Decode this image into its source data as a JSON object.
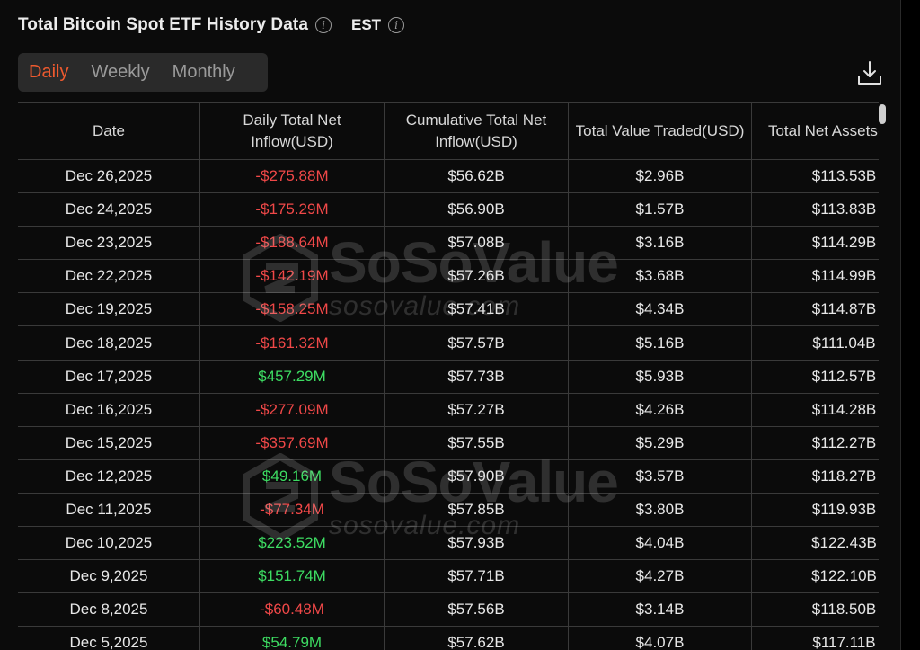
{
  "header": {
    "title": "Total Bitcoin Spot ETF History Data",
    "timezone": "EST",
    "info_glyph": "i"
  },
  "tabs": [
    {
      "label": "Daily",
      "active": true
    },
    {
      "label": "Weekly",
      "active": false
    },
    {
      "label": "Monthly",
      "active": false
    }
  ],
  "colors": {
    "accent": "#ee5a2f",
    "negative": "#f04848",
    "positive": "#3ddc62"
  },
  "table": {
    "columns": [
      "Date",
      "Daily Total Net Inflow(USD)",
      "Cumulative Total Net Inflow(USD)",
      "Total Value Traded(USD)",
      "Total Net Assets(USD)"
    ],
    "rows": [
      {
        "date": "Dec 26,2025",
        "inflow": "-$275.88M",
        "cumulative": "$56.62B",
        "traded": "$2.96B",
        "assets": "$113.53B"
      },
      {
        "date": "Dec 24,2025",
        "inflow": "-$175.29M",
        "cumulative": "$56.90B",
        "traded": "$1.57B",
        "assets": "$113.83B"
      },
      {
        "date": "Dec 23,2025",
        "inflow": "-$188.64M",
        "cumulative": "$57.08B",
        "traded": "$3.16B",
        "assets": "$114.29B"
      },
      {
        "date": "Dec 22,2025",
        "inflow": "-$142.19M",
        "cumulative": "$57.26B",
        "traded": "$3.68B",
        "assets": "$114.99B"
      },
      {
        "date": "Dec 19,2025",
        "inflow": "-$158.25M",
        "cumulative": "$57.41B",
        "traded": "$4.34B",
        "assets": "$114.87B"
      },
      {
        "date": "Dec 18,2025",
        "inflow": "-$161.32M",
        "cumulative": "$57.57B",
        "traded": "$5.16B",
        "assets": "$111.04B"
      },
      {
        "date": "Dec 17,2025",
        "inflow": "$457.29M",
        "cumulative": "$57.73B",
        "traded": "$5.93B",
        "assets": "$112.57B"
      },
      {
        "date": "Dec 16,2025",
        "inflow": "-$277.09M",
        "cumulative": "$57.27B",
        "traded": "$4.26B",
        "assets": "$114.28B"
      },
      {
        "date": "Dec 15,2025",
        "inflow": "-$357.69M",
        "cumulative": "$57.55B",
        "traded": "$5.29B",
        "assets": "$112.27B"
      },
      {
        "date": "Dec 12,2025",
        "inflow": "$49.16M",
        "cumulative": "$57.90B",
        "traded": "$3.57B",
        "assets": "$118.27B"
      },
      {
        "date": "Dec 11,2025",
        "inflow": "-$77.34M",
        "cumulative": "$57.85B",
        "traded": "$3.80B",
        "assets": "$119.93B"
      },
      {
        "date": "Dec 10,2025",
        "inflow": "$223.52M",
        "cumulative": "$57.93B",
        "traded": "$4.04B",
        "assets": "$122.43B"
      },
      {
        "date": "Dec 9,2025",
        "inflow": "$151.74M",
        "cumulative": "$57.71B",
        "traded": "$4.27B",
        "assets": "$122.10B"
      },
      {
        "date": "Dec 8,2025",
        "inflow": "-$60.48M",
        "cumulative": "$57.56B",
        "traded": "$3.14B",
        "assets": "$118.50B"
      },
      {
        "date": "Dec 5,2025",
        "inflow": "$54.79M",
        "cumulative": "$57.62B",
        "traded": "$4.07B",
        "assets": "$117.11B"
      }
    ]
  },
  "watermark": {
    "brand": "SoSoValue",
    "url": "sosovalue.com"
  },
  "icons": {
    "info": "info-icon",
    "download": "download-icon",
    "watermark_logo": "sosovalue-logo-icon"
  }
}
